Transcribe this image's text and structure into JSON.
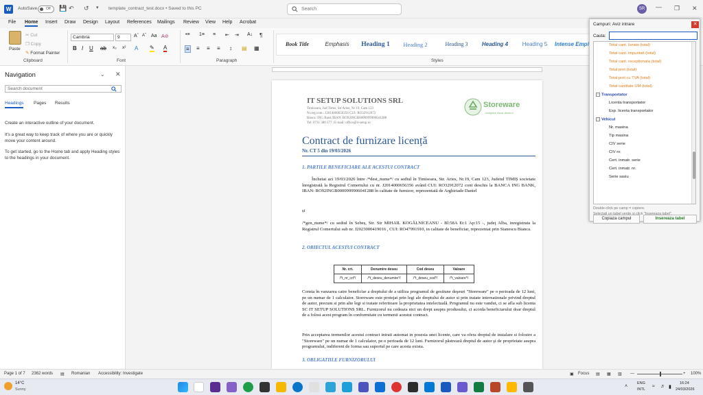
{
  "titlebar": {
    "autosave_label": "AutoSave",
    "autosave_state": "Off",
    "doc_title": "template_contract_test.docx • Saved to this PC",
    "search_placeholder": "Search",
    "user_initials": "SR"
  },
  "menu": [
    "File",
    "Home",
    "Insert",
    "Draw",
    "Design",
    "Layout",
    "References",
    "Mailings",
    "Review",
    "View",
    "Help",
    "Acrobat"
  ],
  "ribbon": {
    "clipboard": {
      "paste": "Paste",
      "cut": "Cut",
      "copy": "Copy",
      "format_painter": "Format Painter",
      "label": "Clipboard"
    },
    "font": {
      "family": "Cambria",
      "size": "9",
      "label": "Font"
    },
    "paragraph": {
      "label": "Paragraph"
    },
    "styles": {
      "label": "Styles",
      "items": [
        "Book Title",
        "Emphasis",
        "Heading 1",
        "Heading 2",
        "Heading 3",
        "Heading 4",
        "Heading 5",
        "Intense Empha"
      ]
    }
  },
  "navigation": {
    "title": "Navigation",
    "search_placeholder": "Search document",
    "tabs": [
      "Headings",
      "Pages",
      "Results"
    ],
    "text1": "Create an interactive outline of your document.",
    "text2": "It's a great way to keep track of where you are or quickly move your content around.",
    "text3": "To get started, go to the Home tab and apply Heading styles to the headings in your document."
  },
  "document": {
    "company": "IT SETUP SOLUTIONS SRL",
    "info": [
      "Timisoara, Jud Timis, Str Aries, Nr 19, Cam 123",
      "Nr.reg.com.: J2014000656356  CUI: RO32912072",
      "Banca: ING Bank   IBAN: RO92INGB0000999906041288",
      "Tel: 0731 386 577 | E-mail: office@it-setup.ro"
    ],
    "logo_text": "Storeware",
    "logo_sub": "Integrare fiscal-deseuri",
    "title": "Contract de furnizare licență",
    "subtitle": "Nr.  CT 5  din 19/03/2026",
    "sec1": "1. PARTILE BENEFICIARE ALE ACESTUI CONTRACT",
    "p1": "Încheiat azi 19/03/2026 între /*dest_nume*/ cu sediul în Timisoara, Str. Aries, Nr.19, Cam 123, Judetul TIMIȘ societate înregistrată la Registrul Comertului  cu  nr.  J2014000656356 având CUI: RO32912072 cont deschis la BANCA ING BANK, IBAN: RO92INGB0000999906041288 în calitate de furnizor, reprezentată de Arghiriade Daniel",
    "si": "și",
    "p2": "/*gen_nume*/ cu sediul în Sebeș, Str. Str MIHAIL KOGĂLNICEANU - Bl:58A Et:1 Ap:15 -, judeţ Alba, inregistrata la Registrul Comertului sub nr. J2023000419016 , CUI: RO47991910, in calitate de beneficiar, reprezentat prin Stanescu Bianca.",
    "sec2": "2. OBIECTUL ACESTUI CONTRACT",
    "table_headers": [
      "Nr. crt.",
      "Denumire deseu",
      "Cod deseu",
      "Valoare"
    ],
    "table_row": [
      "/*t_nr_crt*/",
      "/*t_deseu_denumire*/",
      "/*t_deseu_cod*/",
      "/*t_valoare*/"
    ],
    "p3": "Consta în vanzarea catre beneficiar a dreptului de a utiliza programul de gestiune deşeuri \"Storeware\" pe o perioada de 12 luni, pe un numar de 1 calculator. Storeware este protejat prin legi ale dreptului de autor si prin tratate internationale privind dreptul de autor, precum si prin alte legi si tratate referitoare la proprietatea intelectuală. Programul nu este vandut, ci se afla sub licenta SC IT SETUP SOLUTIONS SRL. Furnizorul nu cedeaza nici un drept asupra produsului, ci acorda beneficiarului doar dreptul de a folosi acest program în conformitate cu termenii acestui contract.",
    "p4": "Prin acceptarea termenilor acestui contract intrati automat in posesia unei licente, care va ofera dreptul de instalare si folosire a \"Storeware\" pe un numar de 1 calculator, pe o perioada de 12 luni. Furnizorul păstrează dreptul de autor şi de proprietate asupra programului, indiferent de forma sau suportul pe care acesta exista.",
    "sec3": "3. OBLIGATIILE FURNIZORULUI"
  },
  "panel": {
    "title": "Campuri: Aviz intrare",
    "search_label": "Cauta:",
    "items_orange": [
      "Total cant. livrata (total)",
      "Total cant. impuritati (total)",
      "Total cant. receptionata (total)",
      "Total pret (total)",
      "Total pret cu TVA (total)",
      "Total cantitate UM (total)"
    ],
    "group_transport": "Transportator",
    "transport_items": [
      "Licenta transportator",
      "Exp. licenta transportator"
    ],
    "group_vehicle": "Vehicul",
    "vehicle_items": [
      "Nr. masina",
      "Tip masina",
      "CIV serie",
      "CIV nr.",
      "Cert. inmatr. serie",
      "Cert. inmatr. nr.",
      "Serie sasiu"
    ],
    "btn_copy": "Copiaza campul",
    "btn_table": "Insereaza tabel",
    "hint1": "Double-click pe camp = copiere.",
    "hint2": "Selectati un tabel verde si click \"Insereaza tabel\"."
  },
  "status": {
    "page": "Page 1 of 7",
    "words": "2362 words",
    "lang": "Romanian",
    "accessibility": "Accessibility: Investigate",
    "focus": "Focus",
    "zoom": "100%"
  },
  "taskbar": {
    "temp": "14°C",
    "weather": "Sunny",
    "lang1": "ENG",
    "lang2": "INTL",
    "time": "16:24",
    "date": "24/03/2026"
  },
  "colors": {
    "accent": "#185abd",
    "heading": "#2b5797",
    "orange_field": "#e87b13",
    "close": "#d23a2a"
  }
}
